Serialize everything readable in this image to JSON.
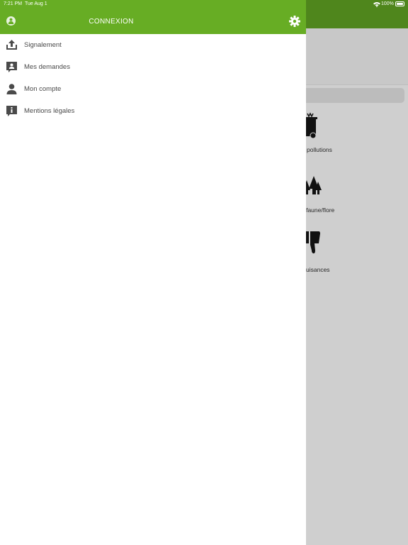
{
  "status_bar": {
    "time": "7:21 PM",
    "date": "Tue Aug 1",
    "battery": "100%"
  },
  "drawer": {
    "title": "CONNEXION",
    "header_color": "#67ad24",
    "items": [
      {
        "label": "Signalement",
        "icon": "upload-icon"
      },
      {
        "label": "Mes demandes",
        "icon": "requests-icon"
      },
      {
        "label": "Mon compte",
        "icon": "person-icon"
      },
      {
        "label": "Mentions légales",
        "icon": "info-icon"
      }
    ]
  },
  "background": {
    "categories": [
      {
        "label": "pollutions",
        "icon": "bin-icon"
      },
      {
        "label": "n faune/flore",
        "icon": "trees-icon"
      },
      {
        "label": "uisances",
        "icon": "thumbs-down-icon"
      }
    ]
  }
}
